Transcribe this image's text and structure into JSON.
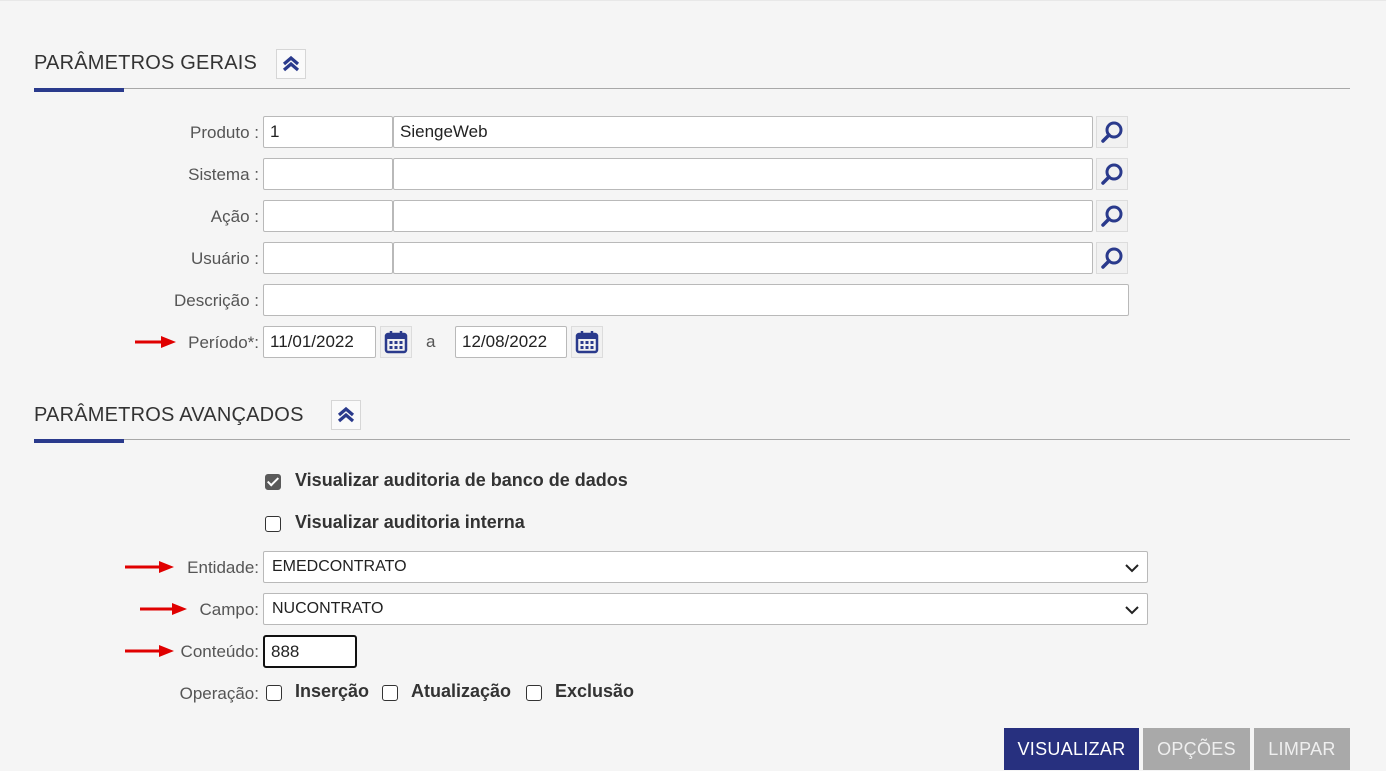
{
  "sections": {
    "general": {
      "title": "PARÂMETROS GERAIS"
    },
    "advanced": {
      "title": "PARÂMETROS AVANÇADOS"
    }
  },
  "fields": {
    "produto": {
      "label": "Produto :",
      "code": "1",
      "name": "SiengeWeb"
    },
    "sistema": {
      "label": "Sistema :",
      "code": "",
      "name": ""
    },
    "acao": {
      "label": "Ação :",
      "code": "",
      "name": ""
    },
    "usuario": {
      "label": "Usuário :",
      "code": "",
      "name": ""
    },
    "descricao": {
      "label": "Descrição :",
      "value": ""
    },
    "periodo": {
      "label": "Período*:",
      "start": "11/01/2022",
      "separator": "a",
      "end": "12/08/2022"
    }
  },
  "advanced": {
    "audit_db": {
      "label": "Visualizar auditoria de banco de dados",
      "checked": true
    },
    "audit_internal": {
      "label": "Visualizar auditoria interna",
      "checked": false
    },
    "entidade": {
      "label": "Entidade:",
      "value": "EMEDCONTRATO"
    },
    "campo": {
      "label": "Campo:",
      "value": "NUCONTRATO"
    },
    "conteudo": {
      "label": "Conteúdo:",
      "value": "888"
    },
    "operacao": {
      "label": "Operação:",
      "options": [
        {
          "label": "Inserção",
          "checked": false
        },
        {
          "label": "Atualização",
          "checked": false
        },
        {
          "label": "Exclusão",
          "checked": false
        }
      ]
    }
  },
  "buttons": {
    "visualizar": "VISUALIZAR",
    "opcoes": "OPÇÕES",
    "limpar": "LIMPAR"
  },
  "colors": {
    "accent": "#27307f",
    "icon": "#2a3a8c",
    "annotation_arrow": "#e00000",
    "disabled": "#a9a9a9"
  },
  "icons": {
    "collapse": "double-chevron-up-icon",
    "lookup": "magnifier-icon",
    "calendar": "calendar-icon",
    "select": "chevron-down-icon",
    "annotation": "red-arrow-icon"
  }
}
